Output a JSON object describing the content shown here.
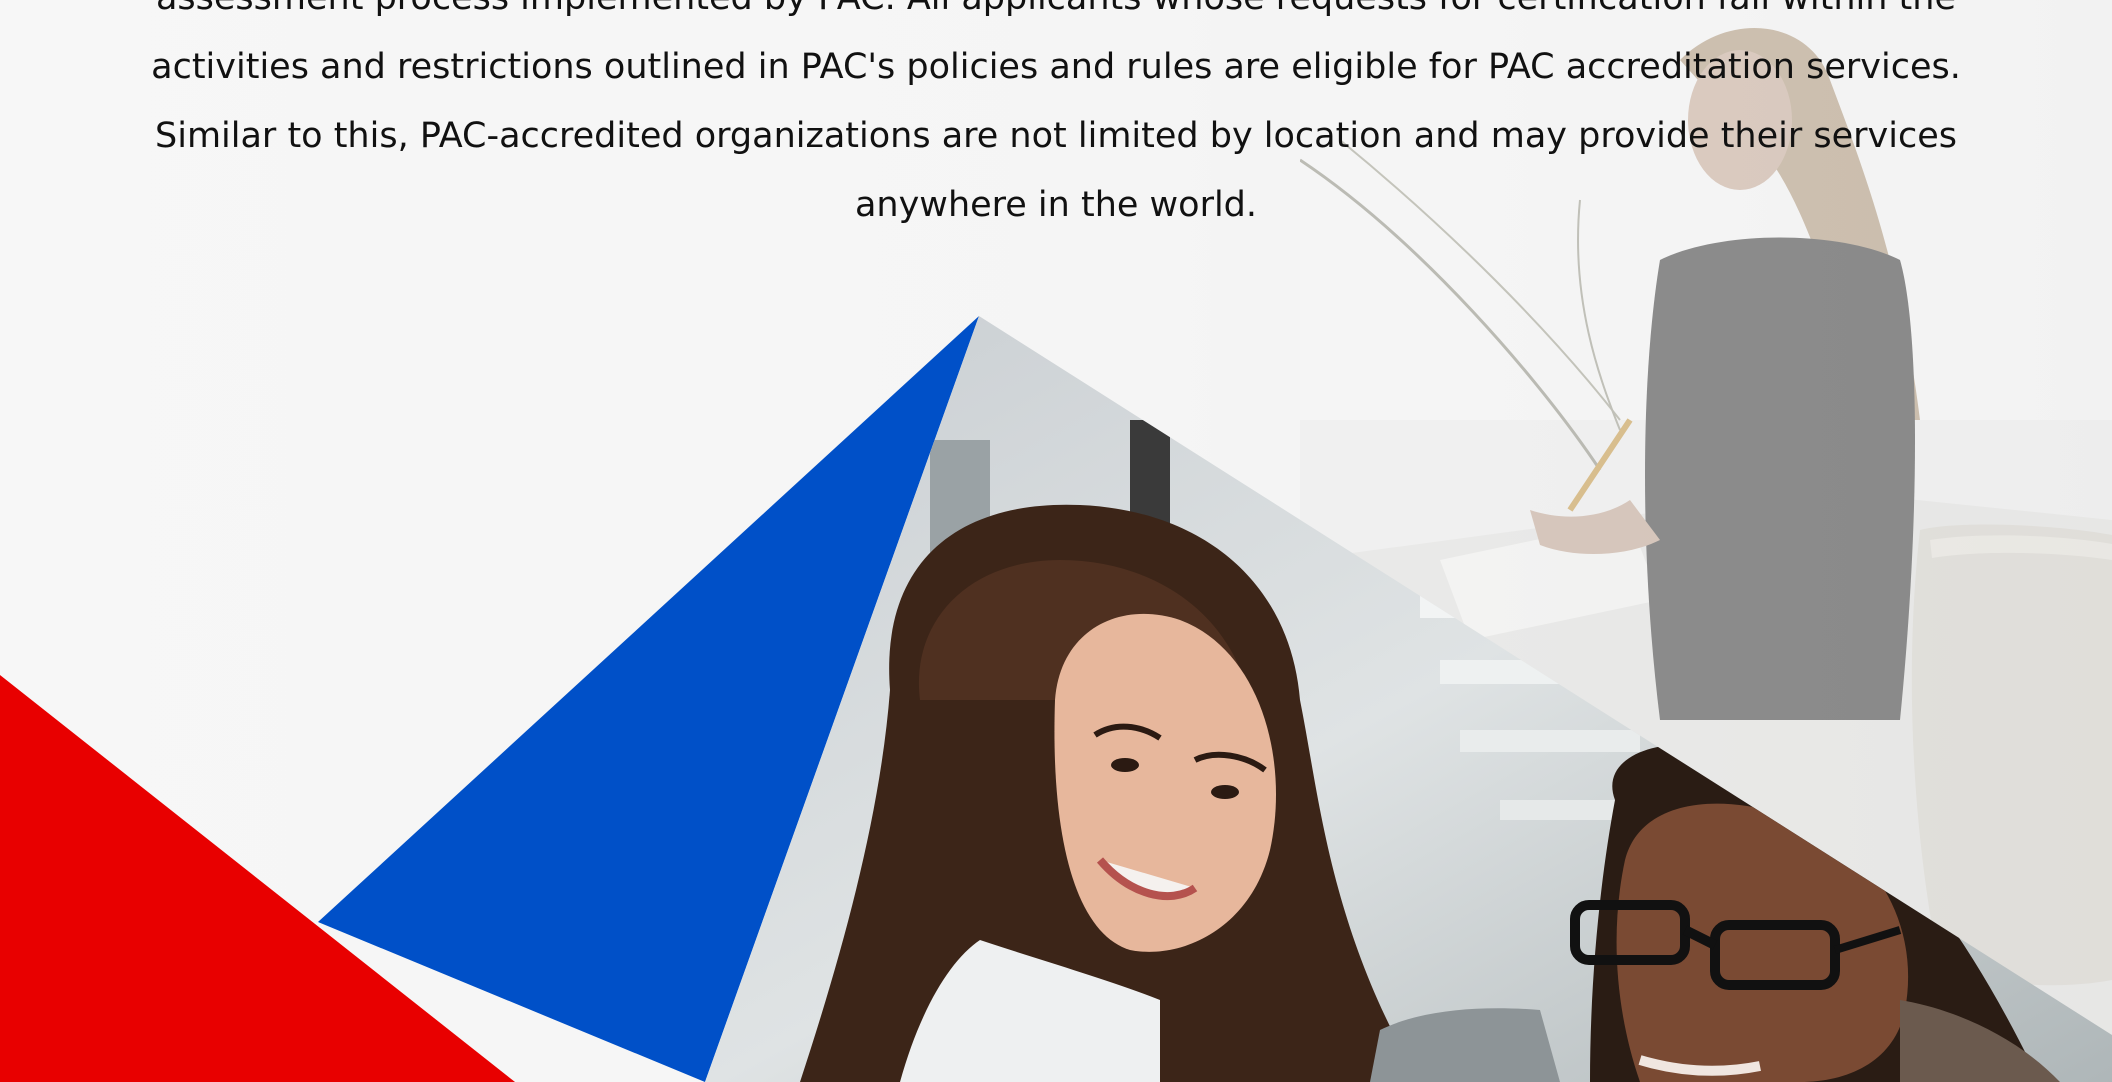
{
  "colors": {
    "accent_red": "#e80000",
    "accent_blue": "#0050c8",
    "text": "#111111",
    "background": "#f6f6f6"
  },
  "intro": {
    "lines": [
      "assessment process implemented by PAC. All applicants whose requests for certification fall within the",
      "activities and restrictions outlined in PAC's policies and rules are eligible for PAC accreditation services.",
      "Similar to this, PAC-accredited organizations are not limited by location and may provide their services",
      "anywhere in the world."
    ]
  },
  "images": {
    "background_photo": "woman-writing-at-desk-photo",
    "main_photo": "women-looking-at-laptop-photo"
  }
}
